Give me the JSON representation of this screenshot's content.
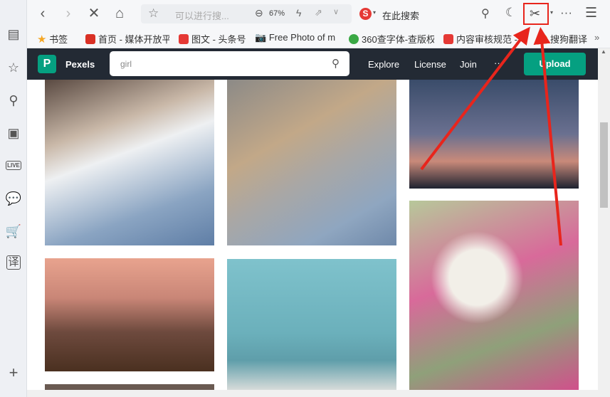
{
  "sidebar": {
    "icons": [
      "news-icon",
      "star-icon",
      "search-icon",
      "video-icon",
      "live-icon",
      "chat-icon",
      "cart-icon",
      "translate-icon",
      "add-icon"
    ],
    "live_label": "LIVE",
    "translate_label": "译"
  },
  "toolbar": {
    "address_placeholder": "可以进行搜...",
    "zoom": "67%",
    "search_placeholder": "在此搜索"
  },
  "bookmarks": [
    {
      "label": "书签",
      "color": "#f5a623"
    },
    {
      "label": "首页 - 媒体开放平",
      "color": "#d93025"
    },
    {
      "label": "图文 - 头条号",
      "color": "#e53935"
    },
    {
      "label": "Free Photo of m",
      "color": "#333333"
    },
    {
      "label": "360查字体-查版权",
      "color": "#3aa845"
    },
    {
      "label": "内容审核规范 -",
      "color": "#e53935"
    },
    {
      "label": "搜狗翻译",
      "color": "#f39c12"
    }
  ],
  "pexels": {
    "brand": "Pexels",
    "search_value": "girl",
    "nav": [
      "Explore",
      "License",
      "Join",
      "···"
    ],
    "upload": "Upload",
    "accent": "#05a081"
  },
  "highlight_color": "#e8251c"
}
